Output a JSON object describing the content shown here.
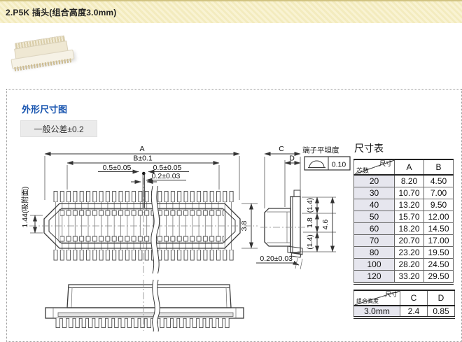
{
  "header": {
    "title": "2.P5K 插头(组合高度3.0mm)"
  },
  "section": {
    "heading": "外形尺寸图",
    "tolerance_label": "一般公差±0.2"
  },
  "drawing": {
    "dim_A": "A",
    "dim_B": "B±0.1",
    "dim_05_left": "0.5±0.05",
    "dim_05_right": "0.5±0.05",
    "dim_02": "0.2±0.03",
    "dim_144": "1.44(吸附面)",
    "dim_38": "3.8",
    "dim_C": "C",
    "dim_D": "D",
    "flatness_label": "端子平坦度",
    "flatness_value": "0.10",
    "dim_14_top": "(1.4)",
    "dim_18": "1.8",
    "dim_14_bottom": "(1.4)",
    "dim_46": "4.6",
    "dim_020": "0.20±0.03"
  },
  "size_table": {
    "title": "尺寸表",
    "corner": {
      "top": "尺寸",
      "bottom": "芯数"
    },
    "columns": [
      "A",
      "B"
    ],
    "rows": [
      [
        "20",
        "8.20",
        "4.50"
      ],
      [
        "30",
        "10.70",
        "7.00"
      ],
      [
        "40",
        "13.20",
        "9.50"
      ],
      [
        "50",
        "15.70",
        "12.00"
      ],
      [
        "60",
        "18.20",
        "14.50"
      ],
      [
        "70",
        "20.70",
        "17.00"
      ],
      [
        "80",
        "23.20",
        "19.50"
      ],
      [
        "100",
        "28.20",
        "24.50"
      ],
      [
        "120",
        "33.20",
        "29.50"
      ]
    ]
  },
  "combo_table": {
    "corner": {
      "top": "尺寸",
      "bottom": "组合高度"
    },
    "columns": [
      "C",
      "D"
    ],
    "rows": [
      [
        "3.0mm",
        "2.4",
        "0.85"
      ]
    ]
  },
  "colors": {
    "header_bg": "#f7f0cc",
    "header_stripe": "#f3ebbe",
    "heading_blue": "#1a56b0",
    "table_shade": "#e6e6ee"
  }
}
